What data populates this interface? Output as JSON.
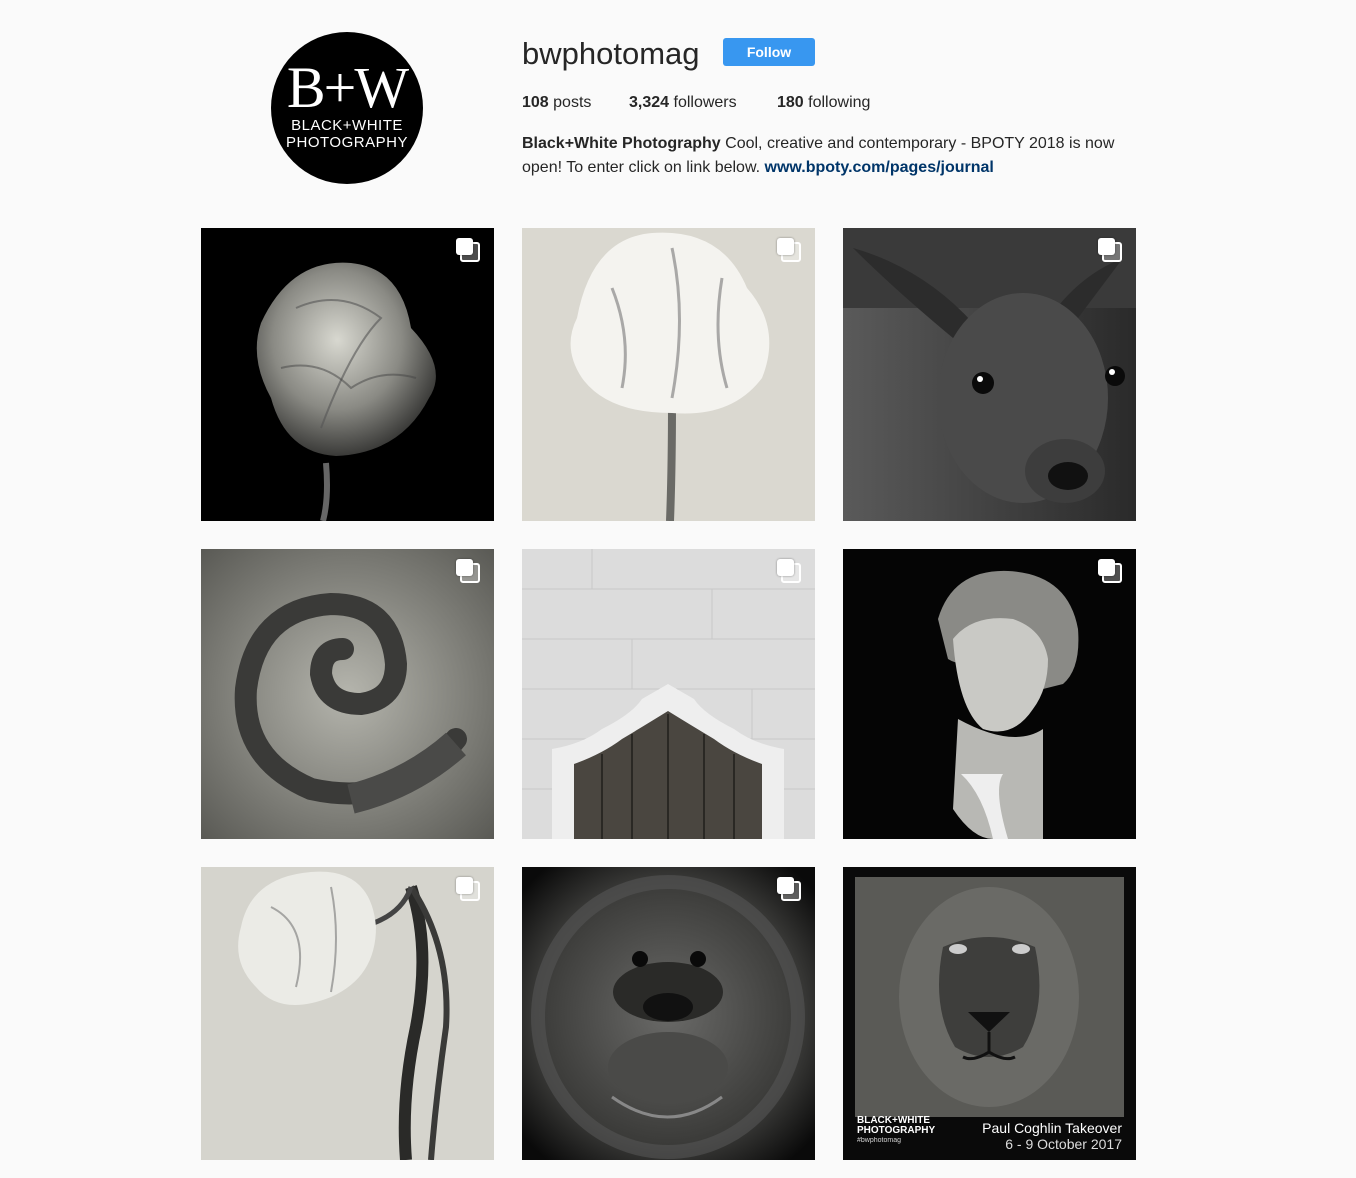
{
  "profile": {
    "avatar": {
      "logo_main": "B+W",
      "logo_line1": "BLACK+WHITE",
      "logo_line2": "PHOTOGRAPHY"
    },
    "username": "bwphotomag",
    "follow_label": "Follow",
    "stats": {
      "posts_count": "108",
      "posts_label": "posts",
      "followers_count": "3,324",
      "followers_label": "followers",
      "following_count": "180",
      "following_label": "following"
    },
    "bio": {
      "name": "Black+White Photography",
      "text": " Cool, creative and contemporary - BPOTY 2018 is now open! To enter click on link below. ",
      "link": "www.bpoty.com/pages/journal"
    }
  },
  "posts": [
    {
      "subject": "tulip on black",
      "multi": true,
      "icon": "multiple-images-icon"
    },
    {
      "subject": "white parrot tulip",
      "multi": true,
      "icon": "multiple-images-icon"
    },
    {
      "subject": "young deer",
      "multi": true,
      "icon": "multiple-images-icon"
    },
    {
      "subject": "spiral leaf",
      "multi": true,
      "icon": "multiple-images-icon"
    },
    {
      "subject": "arched wooden door",
      "multi": true,
      "icon": "multiple-images-icon"
    },
    {
      "subject": "portrait of woman",
      "multi": true,
      "icon": "multiple-images-icon"
    },
    {
      "subject": "drooping tulip",
      "multi": true,
      "icon": "multiple-images-icon"
    },
    {
      "subject": "orangutan",
      "multi": true,
      "icon": "multiple-images-icon"
    },
    {
      "subject": "lion",
      "multi": false,
      "caption_brand_1": "BLACK+WHITE",
      "caption_brand_2": "PHOTOGRAPHY",
      "caption_tag": "#bwphotomag",
      "caption_title": "Paul Coghlin Takeover",
      "caption_dates": "6 - 9 October 2017"
    }
  ],
  "colors": {
    "background": "#fafafa",
    "follow_button": "#3897f0",
    "link": "#003569"
  }
}
